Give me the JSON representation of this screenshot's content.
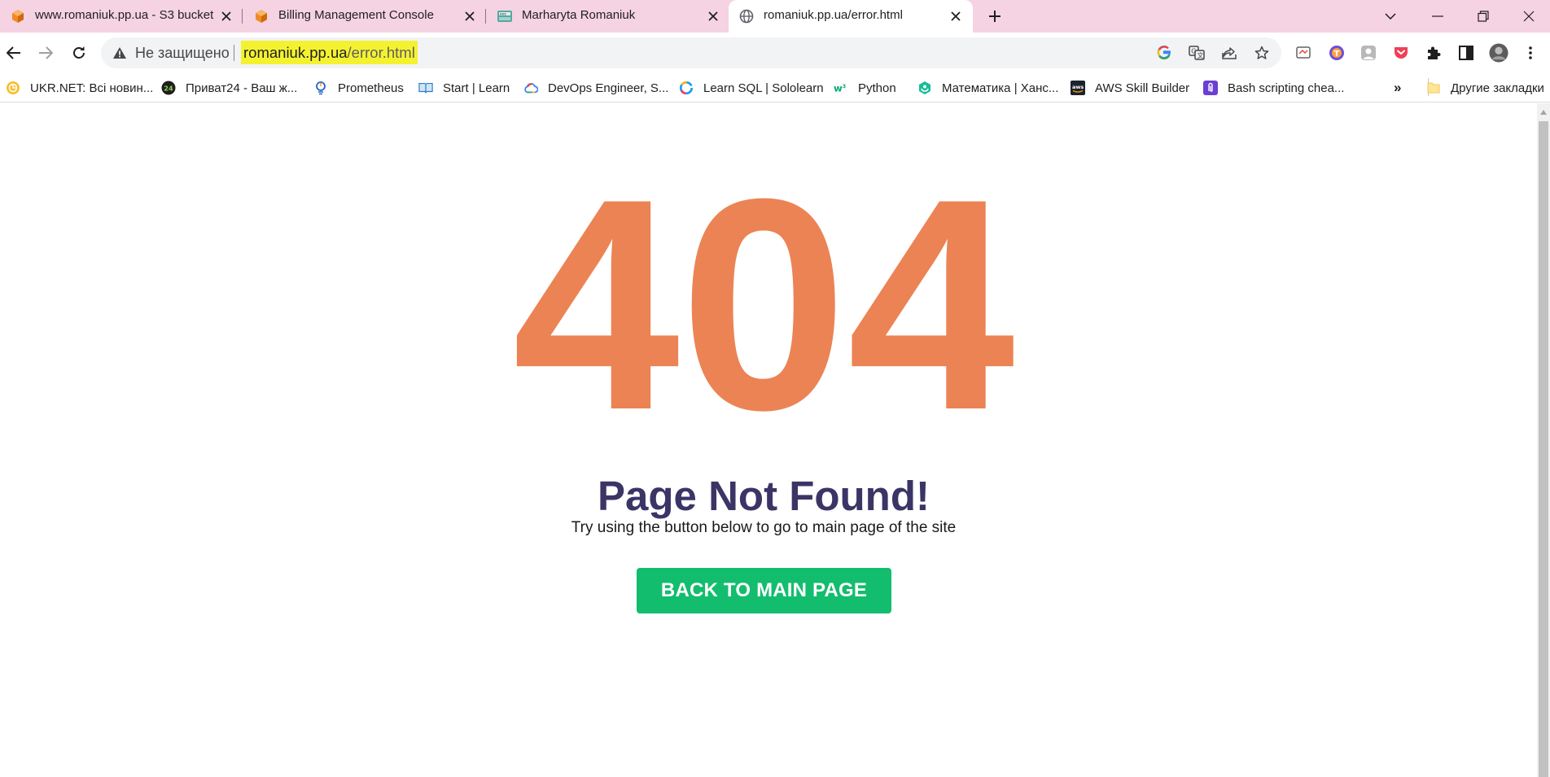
{
  "tabs": [
    {
      "title": "www.romaniuk.pp.ua - S3 bucket",
      "favicon": "aws-s3-cube-icon",
      "active": false
    },
    {
      "title": "Billing Management Console",
      "favicon": "aws-cube-icon",
      "active": false
    },
    {
      "title": "Marharyta Romaniuk",
      "favicon": "aws-training-icon",
      "active": false
    },
    {
      "title": "romaniuk.pp.ua/error.html",
      "favicon": "globe-icon",
      "active": true
    }
  ],
  "omnibox": {
    "security_label": "Не защищено",
    "url_host": "romaniuk.pp.ua",
    "url_path": "/error.html"
  },
  "bookmarks": [
    {
      "label": "UKR.NET: Всі новин...",
      "icon": "ukrnet-icon"
    },
    {
      "label": "Приват24 - Ваш ж...",
      "icon": "privat24-icon"
    },
    {
      "label": "Prometheus",
      "icon": "prometheus-icon"
    },
    {
      "label": "Start | Learn",
      "icon": "learn-book-icon"
    },
    {
      "label": "DevOps Engineer, S...",
      "icon": "google-cloud-icon"
    },
    {
      "label": "Learn SQL | Sololearn",
      "icon": "sololearn-icon"
    },
    {
      "label": "Python",
      "icon": "w3schools-icon"
    },
    {
      "label": "Математика | Ханс...",
      "icon": "khan-academy-icon"
    },
    {
      "label": "AWS Skill Builder",
      "icon": "aws-icon"
    },
    {
      "label": "Bash scripting chea...",
      "icon": "clip-icon"
    }
  ],
  "bookmarks_overflow": "»",
  "other_bookmarks": "Другие закладки",
  "page": {
    "code": "404",
    "title": "Page Not Found!",
    "subtitle": "Try using the button below to go to main page of the site",
    "button_label": "BACK TO MAIN PAGE"
  },
  "colors": {
    "tabstrip": "#f5d3e3",
    "code": "#ec8354",
    "title": "#3b3566",
    "button": "#13bd6e",
    "url_highlight": "#f4f230"
  }
}
